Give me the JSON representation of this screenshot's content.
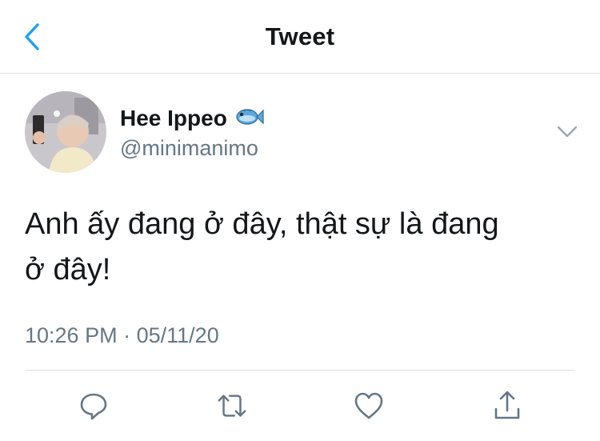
{
  "nav": {
    "title": "Tweet"
  },
  "tweet": {
    "display_name": "Hee Ippeo",
    "handle": "@minimanimo",
    "text_line1": "Anh ấy đang ở đây, thật sự là đang",
    "text_line2": "ở đây!",
    "time": "10:26 PM",
    "separator": "·",
    "date": "05/11/20"
  },
  "icons": {
    "back": "chevron-left-icon",
    "name_emoji": "fish-icon",
    "more": "chevron-down-icon",
    "reply": "speech-bubble-icon",
    "retweet": "retweet-arrows-icon",
    "like": "heart-outline-icon",
    "share": "share-upload-icon"
  },
  "colors": {
    "accent": "#1da1f2",
    "text": "#14171a",
    "secondary": "#657786",
    "divider": "#dfe3e6"
  }
}
